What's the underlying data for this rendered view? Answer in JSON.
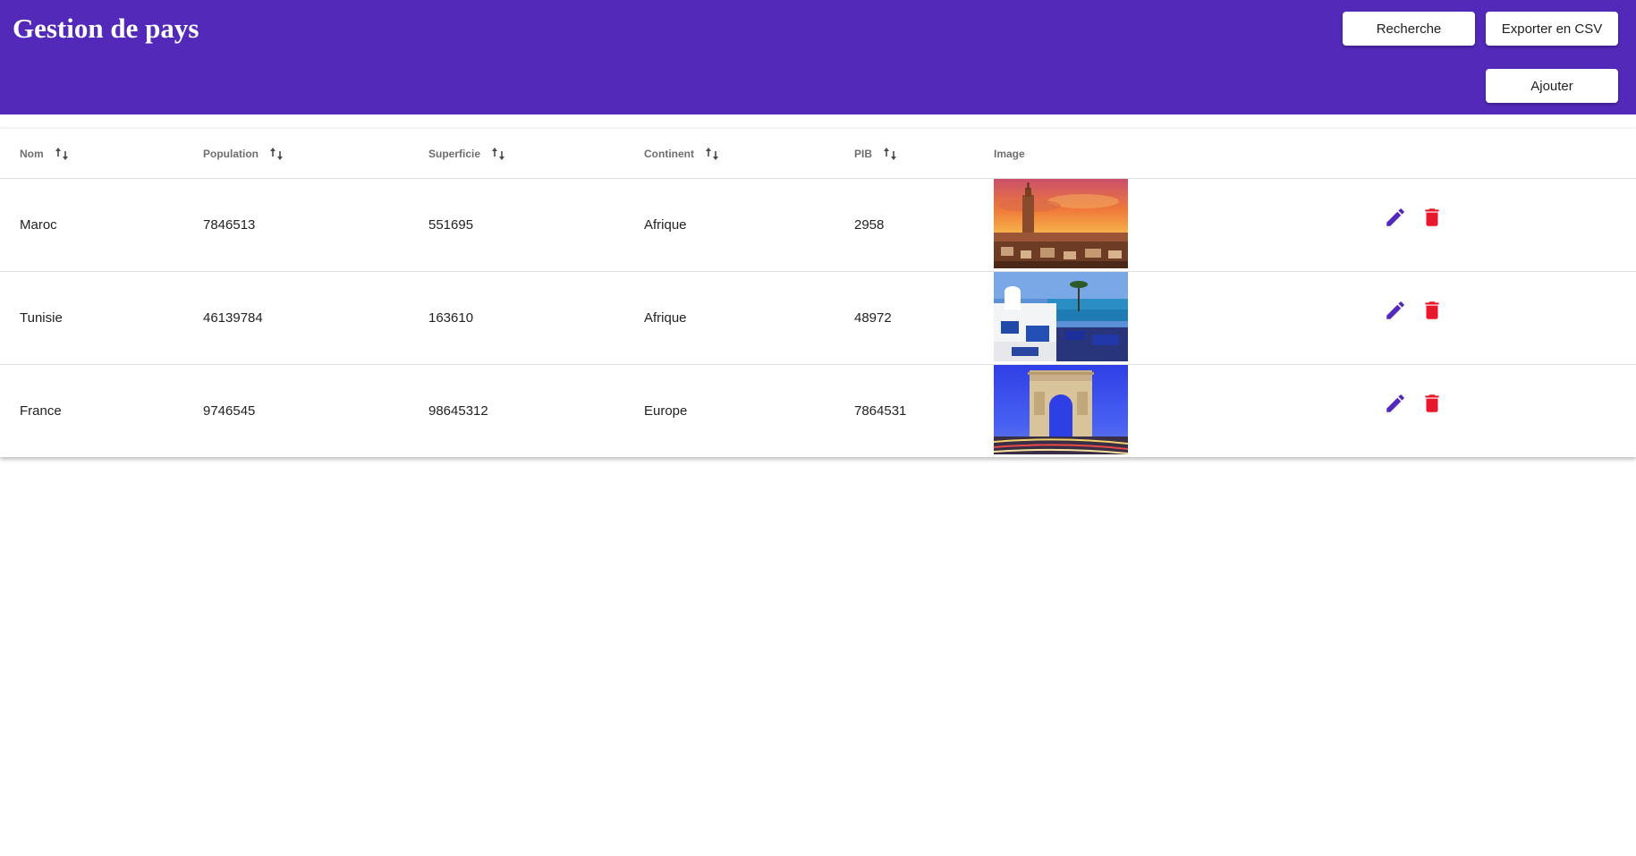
{
  "header": {
    "title": "Gestion de pays",
    "search_label": "Recherche",
    "export_label": "Exporter en CSV",
    "add_label": "Ajouter"
  },
  "colors": {
    "primary": "#5229b8",
    "delete": "#e8192c",
    "edit": "#5229b8"
  },
  "table": {
    "columns": [
      {
        "label": "Nom",
        "sortable": true
      },
      {
        "label": "Population",
        "sortable": true
      },
      {
        "label": "Superficie",
        "sortable": true
      },
      {
        "label": "Continent",
        "sortable": true
      },
      {
        "label": "PIB",
        "sortable": true
      },
      {
        "label": "Image",
        "sortable": false
      }
    ],
    "rows": [
      {
        "nom": "Maroc",
        "population": "7846513",
        "superficie": "551695",
        "continent": "Afrique",
        "pib": "2958",
        "image": "koutoubia-sunset"
      },
      {
        "nom": "Tunisie",
        "population": "46139784",
        "superficie": "163610",
        "continent": "Afrique",
        "pib": "48972",
        "image": "sidi-bou-said"
      },
      {
        "nom": "France",
        "population": "9746545",
        "superficie": "98645312",
        "continent": "Europe",
        "pib": "7864531",
        "image": "arc-de-triomphe"
      }
    ],
    "row_icons": {
      "edit": "pencil-icon",
      "delete": "trash-icon"
    }
  }
}
